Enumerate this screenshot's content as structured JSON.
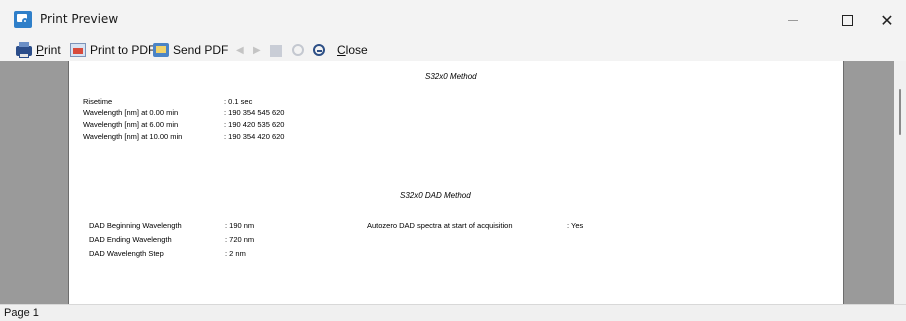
{
  "window": {
    "title": "Print Preview",
    "controls": {
      "minimize": "—",
      "maximize": "",
      "close": "✕"
    }
  },
  "toolbar": {
    "print_label_prefix": "",
    "print_mnemonic": "P",
    "print_label_rest": "rint",
    "print_to_pdf_label": "Print to PDF",
    "send_pdf_label": "Send PDF",
    "close_mnemonic": "C",
    "close_label_rest": "lose",
    "icons": [
      "printer-icon",
      "pdf-icon",
      "send-pdf-icon",
      "previous-page-icon",
      "next-page-icon",
      "multi-page-icon",
      "zoom-in-icon",
      "zoom-out-icon"
    ]
  },
  "document": {
    "method_title": "S32x0 Method",
    "method_rows": [
      {
        "label": "Risetime",
        "value": ": 0.1 sec"
      },
      {
        "label": "Wavelength [nm] at 0.00 min",
        "value": ": 190  354  545  620"
      },
      {
        "label": "Wavelength [nm] at 6.00 min",
        "value": ": 190  420  535  620"
      },
      {
        "label": "Wavelength [nm] at 10.00 min",
        "value": ": 190  354  420  620"
      }
    ],
    "dad_title": "S32x0 DAD Method",
    "dad_rows": [
      {
        "label": "DAD Beginning Wavelength",
        "value": ": 190 nm"
      },
      {
        "label": "DAD Ending Wavelength",
        "value": ": 720 nm"
      },
      {
        "label": "DAD Wavelength Step",
        "value": ": 2 nm"
      }
    ],
    "autozero": {
      "label": "Autozero DAD spectra at start of acquisition",
      "value": ": Yes"
    }
  },
  "status": {
    "page": "Page 1"
  }
}
